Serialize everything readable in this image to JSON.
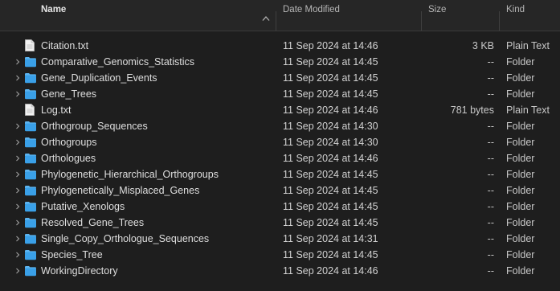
{
  "columns": {
    "name": "Name",
    "date": "Date Modified",
    "size": "Size",
    "kind": "Kind"
  },
  "colors": {
    "folder": "#3aa0e8",
    "folder_tab": "#5cb4f0",
    "background": "#1e1e1e"
  },
  "rows": [
    {
      "type": "file",
      "name": "Citation.txt",
      "date": "11 Sep 2024 at 14:46",
      "size": "3 KB",
      "kind": "Plain Text"
    },
    {
      "type": "folder",
      "name": "Comparative_Genomics_Statistics",
      "date": "11 Sep 2024 at 14:45",
      "size": "--",
      "kind": "Folder"
    },
    {
      "type": "folder",
      "name": "Gene_Duplication_Events",
      "date": "11 Sep 2024 at 14:45",
      "size": "--",
      "kind": "Folder"
    },
    {
      "type": "folder",
      "name": "Gene_Trees",
      "date": "11 Sep 2024 at 14:45",
      "size": "--",
      "kind": "Folder"
    },
    {
      "type": "file",
      "name": "Log.txt",
      "date": "11 Sep 2024 at 14:46",
      "size": "781 bytes",
      "kind": "Plain Text"
    },
    {
      "type": "folder",
      "name": "Orthogroup_Sequences",
      "date": "11 Sep 2024 at 14:30",
      "size": "--",
      "kind": "Folder"
    },
    {
      "type": "folder",
      "name": "Orthogroups",
      "date": "11 Sep 2024 at 14:30",
      "size": "--",
      "kind": "Folder"
    },
    {
      "type": "folder",
      "name": "Orthologues",
      "date": "11 Sep 2024 at 14:46",
      "size": "--",
      "kind": "Folder"
    },
    {
      "type": "folder",
      "name": "Phylogenetic_Hierarchical_Orthogroups",
      "date": "11 Sep 2024 at 14:45",
      "size": "--",
      "kind": "Folder"
    },
    {
      "type": "folder",
      "name": "Phylogenetically_Misplaced_Genes",
      "date": "11 Sep 2024 at 14:45",
      "size": "--",
      "kind": "Folder"
    },
    {
      "type": "folder",
      "name": "Putative_Xenologs",
      "date": "11 Sep 2024 at 14:45",
      "size": "--",
      "kind": "Folder"
    },
    {
      "type": "folder",
      "name": "Resolved_Gene_Trees",
      "date": "11 Sep 2024 at 14:45",
      "size": "--",
      "kind": "Folder"
    },
    {
      "type": "folder",
      "name": "Single_Copy_Orthologue_Sequences",
      "date": "11 Sep 2024 at 14:31",
      "size": "--",
      "kind": "Folder"
    },
    {
      "type": "folder",
      "name": "Species_Tree",
      "date": "11 Sep 2024 at 14:45",
      "size": "--",
      "kind": "Folder"
    },
    {
      "type": "folder",
      "name": "WorkingDirectory",
      "date": "11 Sep 2024 at 14:46",
      "size": "--",
      "kind": "Folder"
    }
  ]
}
